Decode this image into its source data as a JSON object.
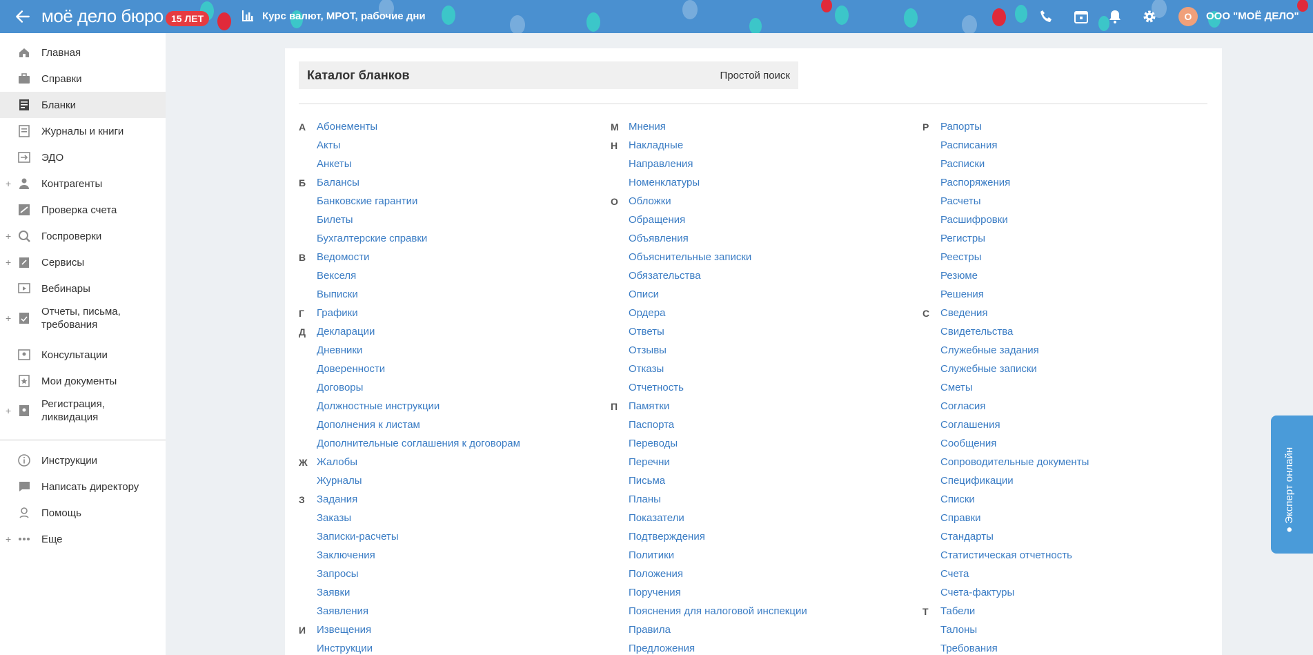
{
  "header": {
    "logo_text": "моё дело бюро",
    "badge": "15 ЛЕТ",
    "rates_link": "Курс валют, МРОТ, рабочие дни",
    "avatar_letter": "О",
    "company": "ООО \"МОЁ ДЕЛО\"",
    "colors": {
      "bar": "#4a90d0",
      "badge": "#e63b40",
      "avatar": "#f0a07a"
    }
  },
  "sidebar": {
    "items": [
      {
        "label": "Главная",
        "icon": "home-icon",
        "plus": false
      },
      {
        "label": "Справки",
        "icon": "briefcase-icon",
        "plus": false
      },
      {
        "label": "Бланки",
        "icon": "forms-icon",
        "plus": false,
        "active": true
      },
      {
        "label": "Журналы и книги",
        "icon": "journal-icon",
        "plus": false
      },
      {
        "label": "ЭДО",
        "icon": "edo-icon",
        "plus": false
      },
      {
        "label": "Контрагенты",
        "icon": "contractor-icon",
        "plus": true
      },
      {
        "label": "Проверка счета",
        "icon": "account-check-icon",
        "plus": false
      },
      {
        "label": "Госпроверки",
        "icon": "magnifier-icon",
        "plus": true
      },
      {
        "label": "Сервисы",
        "icon": "services-icon",
        "plus": true
      },
      {
        "label": "Вебинары",
        "icon": "webinar-icon",
        "plus": false
      },
      {
        "label": "Отчеты, письма, требования",
        "icon": "report-icon",
        "plus": true
      },
      {
        "label": "Консультации",
        "icon": "consult-icon",
        "plus": false
      },
      {
        "label": "Мои документы",
        "icon": "star-document-icon",
        "plus": false
      },
      {
        "label": "Регистрация, ликвидация",
        "icon": "registration-icon",
        "plus": true
      },
      {
        "label": "Инструкции",
        "icon": "info-icon",
        "plus": false
      },
      {
        "label": "Написать директору",
        "icon": "chat-icon",
        "plus": false
      },
      {
        "label": "Помощь",
        "icon": "help-icon",
        "plus": false
      },
      {
        "label": "Еще",
        "icon": "more-icon",
        "plus": true
      }
    ]
  },
  "catalog": {
    "title": "Каталог бланков",
    "simple_search": "Простой поиск",
    "columns": [
      [
        {
          "letter": "А",
          "label": "Абонементы"
        },
        {
          "letter": "",
          "label": "Акты"
        },
        {
          "letter": "",
          "label": "Анкеты"
        },
        {
          "letter": "Б",
          "label": "Балансы"
        },
        {
          "letter": "",
          "label": "Банковские гарантии"
        },
        {
          "letter": "",
          "label": "Билеты"
        },
        {
          "letter": "",
          "label": "Бухгалтерские справки"
        },
        {
          "letter": "В",
          "label": "Ведомости"
        },
        {
          "letter": "",
          "label": "Векселя"
        },
        {
          "letter": "",
          "label": "Выписки"
        },
        {
          "letter": "Г",
          "label": "Графики"
        },
        {
          "letter": "Д",
          "label": "Декларации"
        },
        {
          "letter": "",
          "label": "Дневники"
        },
        {
          "letter": "",
          "label": "Доверенности"
        },
        {
          "letter": "",
          "label": "Договоры"
        },
        {
          "letter": "",
          "label": "Должностные инструкции"
        },
        {
          "letter": "",
          "label": "Дополнения к листам"
        },
        {
          "letter": "",
          "label": "Дополнительные соглашения к договорам"
        },
        {
          "letter": "Ж",
          "label": "Жалобы"
        },
        {
          "letter": "",
          "label": "Журналы"
        },
        {
          "letter": "З",
          "label": "Задания"
        },
        {
          "letter": "",
          "label": "Заказы"
        },
        {
          "letter": "",
          "label": "Записки-расчеты"
        },
        {
          "letter": "",
          "label": "Заключения"
        },
        {
          "letter": "",
          "label": "Запросы"
        },
        {
          "letter": "",
          "label": "Заявки"
        },
        {
          "letter": "",
          "label": "Заявления"
        },
        {
          "letter": "И",
          "label": "Извещения"
        },
        {
          "letter": "",
          "label": "Инструкции"
        }
      ],
      [
        {
          "letter": "М",
          "label": "Мнения"
        },
        {
          "letter": "Н",
          "label": "Накладные"
        },
        {
          "letter": "",
          "label": "Направления"
        },
        {
          "letter": "",
          "label": "Номенклатуры"
        },
        {
          "letter": "О",
          "label": "Обложки"
        },
        {
          "letter": "",
          "label": "Обращения"
        },
        {
          "letter": "",
          "label": "Объявления"
        },
        {
          "letter": "",
          "label": "Объяснительные записки"
        },
        {
          "letter": "",
          "label": "Обязательства"
        },
        {
          "letter": "",
          "label": "Описи"
        },
        {
          "letter": "",
          "label": "Ордера"
        },
        {
          "letter": "",
          "label": "Ответы"
        },
        {
          "letter": "",
          "label": "Отзывы"
        },
        {
          "letter": "",
          "label": "Отказы"
        },
        {
          "letter": "",
          "label": "Отчетность"
        },
        {
          "letter": "П",
          "label": "Памятки"
        },
        {
          "letter": "",
          "label": "Паспорта"
        },
        {
          "letter": "",
          "label": "Переводы"
        },
        {
          "letter": "",
          "label": "Перечни"
        },
        {
          "letter": "",
          "label": "Письма"
        },
        {
          "letter": "",
          "label": "Планы"
        },
        {
          "letter": "",
          "label": "Показатели"
        },
        {
          "letter": "",
          "label": "Подтверждения"
        },
        {
          "letter": "",
          "label": "Политики"
        },
        {
          "letter": "",
          "label": "Положения"
        },
        {
          "letter": "",
          "label": "Поручения"
        },
        {
          "letter": "",
          "label": "Пояснения для налоговой инспекции"
        },
        {
          "letter": "",
          "label": "Правила"
        },
        {
          "letter": "",
          "label": "Предложения"
        }
      ],
      [
        {
          "letter": "Р",
          "label": "Рапорты"
        },
        {
          "letter": "",
          "label": "Расписания"
        },
        {
          "letter": "",
          "label": "Расписки"
        },
        {
          "letter": "",
          "label": "Распоряжения"
        },
        {
          "letter": "",
          "label": "Расчеты"
        },
        {
          "letter": "",
          "label": "Расшифровки"
        },
        {
          "letter": "",
          "label": "Регистры"
        },
        {
          "letter": "",
          "label": "Реестры"
        },
        {
          "letter": "",
          "label": "Резюме"
        },
        {
          "letter": "",
          "label": "Решения"
        },
        {
          "letter": "С",
          "label": "Сведения"
        },
        {
          "letter": "",
          "label": "Свидетельства"
        },
        {
          "letter": "",
          "label": "Служебные задания"
        },
        {
          "letter": "",
          "label": "Служебные записки"
        },
        {
          "letter": "",
          "label": "Сметы"
        },
        {
          "letter": "",
          "label": "Согласия"
        },
        {
          "letter": "",
          "label": "Соглашения"
        },
        {
          "letter": "",
          "label": "Сообщения"
        },
        {
          "letter": "",
          "label": "Сопроводительные документы"
        },
        {
          "letter": "",
          "label": "Спецификации"
        },
        {
          "letter": "",
          "label": "Списки"
        },
        {
          "letter": "",
          "label": "Справки"
        },
        {
          "letter": "",
          "label": "Стандарты"
        },
        {
          "letter": "",
          "label": "Статистическая отчетность"
        },
        {
          "letter": "",
          "label": "Счета"
        },
        {
          "letter": "",
          "label": "Счета-фактуры"
        },
        {
          "letter": "Т",
          "label": "Табели"
        },
        {
          "letter": "",
          "label": "Талоны"
        },
        {
          "letter": "",
          "label": "Требования"
        }
      ]
    ],
    "link_color": "#3a7cc4"
  },
  "expert_tab": {
    "label": "● Эксперт онлайн",
    "color": "#4a9bd9"
  }
}
